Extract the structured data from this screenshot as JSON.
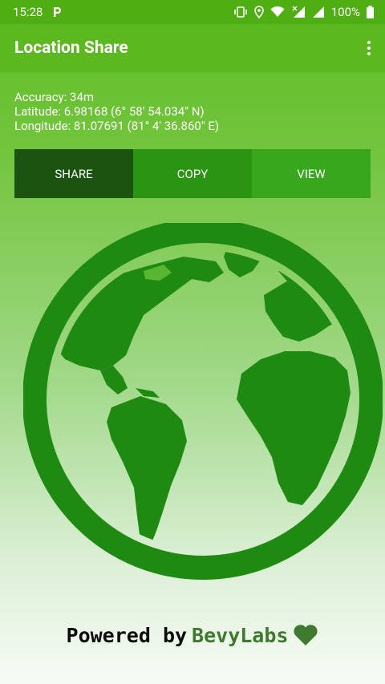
{
  "status_bar": {
    "time": "15:28",
    "notification_icon": "p-parking-icon",
    "battery": "100%",
    "icons": [
      "vibrate-icon",
      "location-icon",
      "wifi-icon",
      "signal-icon",
      "signal-icon",
      "battery-icon"
    ]
  },
  "app_bar": {
    "title": "Location Share",
    "overflow_icon": "more-vert-icon"
  },
  "location": {
    "accuracy": "Accuracy: 34m",
    "latitude": "Latitude: 6.98168 (6° 58' 54.034\" N)",
    "longitude": "Longitude: 81.07691 (81°  4' 36.860\" E)"
  },
  "actions": {
    "share": "SHARE",
    "copy": "COPY",
    "view": "VIEW"
  },
  "footer": {
    "powered_by": "Powered by",
    "brand": "BevyLabs",
    "heart_icon": "heart-icon"
  },
  "colors": {
    "status_bar": "#4fae12",
    "app_bar": "#5bb81e",
    "share_button": "#1a5410",
    "copy_button": "#2b9412",
    "view_button": "#38a71d",
    "globe": "#1f8a12",
    "brand": "#3d7a2e"
  }
}
